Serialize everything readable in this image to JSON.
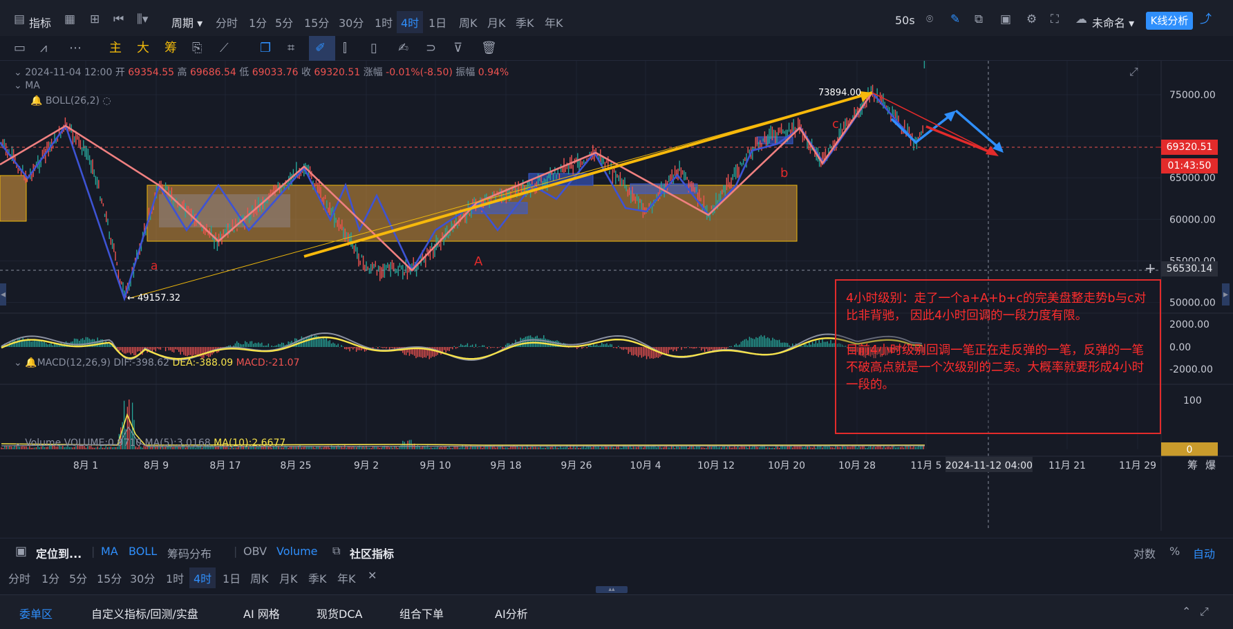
{
  "colors": {
    "accent": "#2f8ffc",
    "up": "#26a69a",
    "down": "#ef5350",
    "annotation": "#e32b2b",
    "gold": "#f0b90b"
  },
  "header": {
    "indicators": "指标",
    "period_label": "周期",
    "timeframes": [
      "分时",
      "1分",
      "5分",
      "15分",
      "30分",
      "1时",
      "4时",
      "1日",
      "周K",
      "月K",
      "季K",
      "年K"
    ],
    "active_timeframe": "4时",
    "refresh": "50s",
    "layout_name": "未命名",
    "kline_button": "K线分析"
  },
  "drawing_toolbar": {
    "zhu": "主",
    "da": "大",
    "chou": "筹"
  },
  "legend": {
    "datetime": "2024-11-04 12:00",
    "open_label": "开",
    "open": "69354.55",
    "high_label": "高",
    "high": "69686.54",
    "low_label": "低",
    "low": "69033.76",
    "close_label": "收",
    "close": "69320.51",
    "change_label": "涨幅",
    "change": "-0.01%(-8.50)",
    "amplitude_label": "振幅",
    "amplitude": "0.94%",
    "ma": "MA",
    "boll": "BOLL(26,2)"
  },
  "price_axis": [
    "75000.00",
    "65000.00",
    "60000.00",
    "55000.00",
    "50000.00"
  ],
  "price_tags": {
    "current": "69320.51",
    "countdown": "01:43:50",
    "crosshair": "56530.14"
  },
  "chart_labels": {
    "high": "73894.00",
    "low": "← 49157.32",
    "a": "a",
    "A": "A",
    "b": "b",
    "c": "c"
  },
  "macd": {
    "title": "MACD(12,26,9)",
    "dif": "DIF:-398.62",
    "dea": "DEA:-388.09",
    "macd": "MACD:-21.07",
    "axis": [
      "2000.00",
      "0.00",
      "-2000.00"
    ]
  },
  "volume": {
    "title": "Volume",
    "volume": "VOLUME:0.9710",
    "ma5": "MA(5):3.0168",
    "ma10": "MA(10):2.6677",
    "axis": [
      "100",
      "0"
    ]
  },
  "time_axis": [
    "8月 1",
    "8月 9",
    "8月 17",
    "8月 25",
    "9月 2",
    "9月 10",
    "9月 18",
    "9月 26",
    "10月 4",
    "10月 12",
    "10月 20",
    "10月 28",
    "11月 5",
    "11月 21",
    "11月 29"
  ],
  "crosshair_time": "2024-11-12 04:00",
  "axis_corner": [
    "筹",
    "爆"
  ],
  "annotation": {
    "para1": "4小时级别：走了一个a+A+b+c的完美盘整走势b与c对比非背驰， 因此4小时回调的一段力度有限。",
    "para2": "目前4小时级别回调一笔正在走反弹的一笔，反弹的一笔不破高点就是一个次级别的二卖。大概率就要形成4小时一段的。"
  },
  "indicator_bar": {
    "locate": "定位到...",
    "ma": "MA",
    "boll": "BOLL",
    "chips": "筹码分布",
    "obv": "OBV",
    "volume": "Volume",
    "community": "社区指标",
    "log": "对数",
    "percent": "%",
    "auto": "自动"
  },
  "bottom_timeframes": [
    "分时",
    "1分",
    "5分",
    "15分",
    "30分",
    "1时",
    "4时",
    "1日",
    "周K",
    "月K",
    "季K",
    "年K"
  ],
  "bottom_tabs": [
    "委单区",
    "自定义指标/回测/实盘",
    "AI 网格",
    "现货DCA",
    "组合下单",
    "AI分析"
  ]
}
